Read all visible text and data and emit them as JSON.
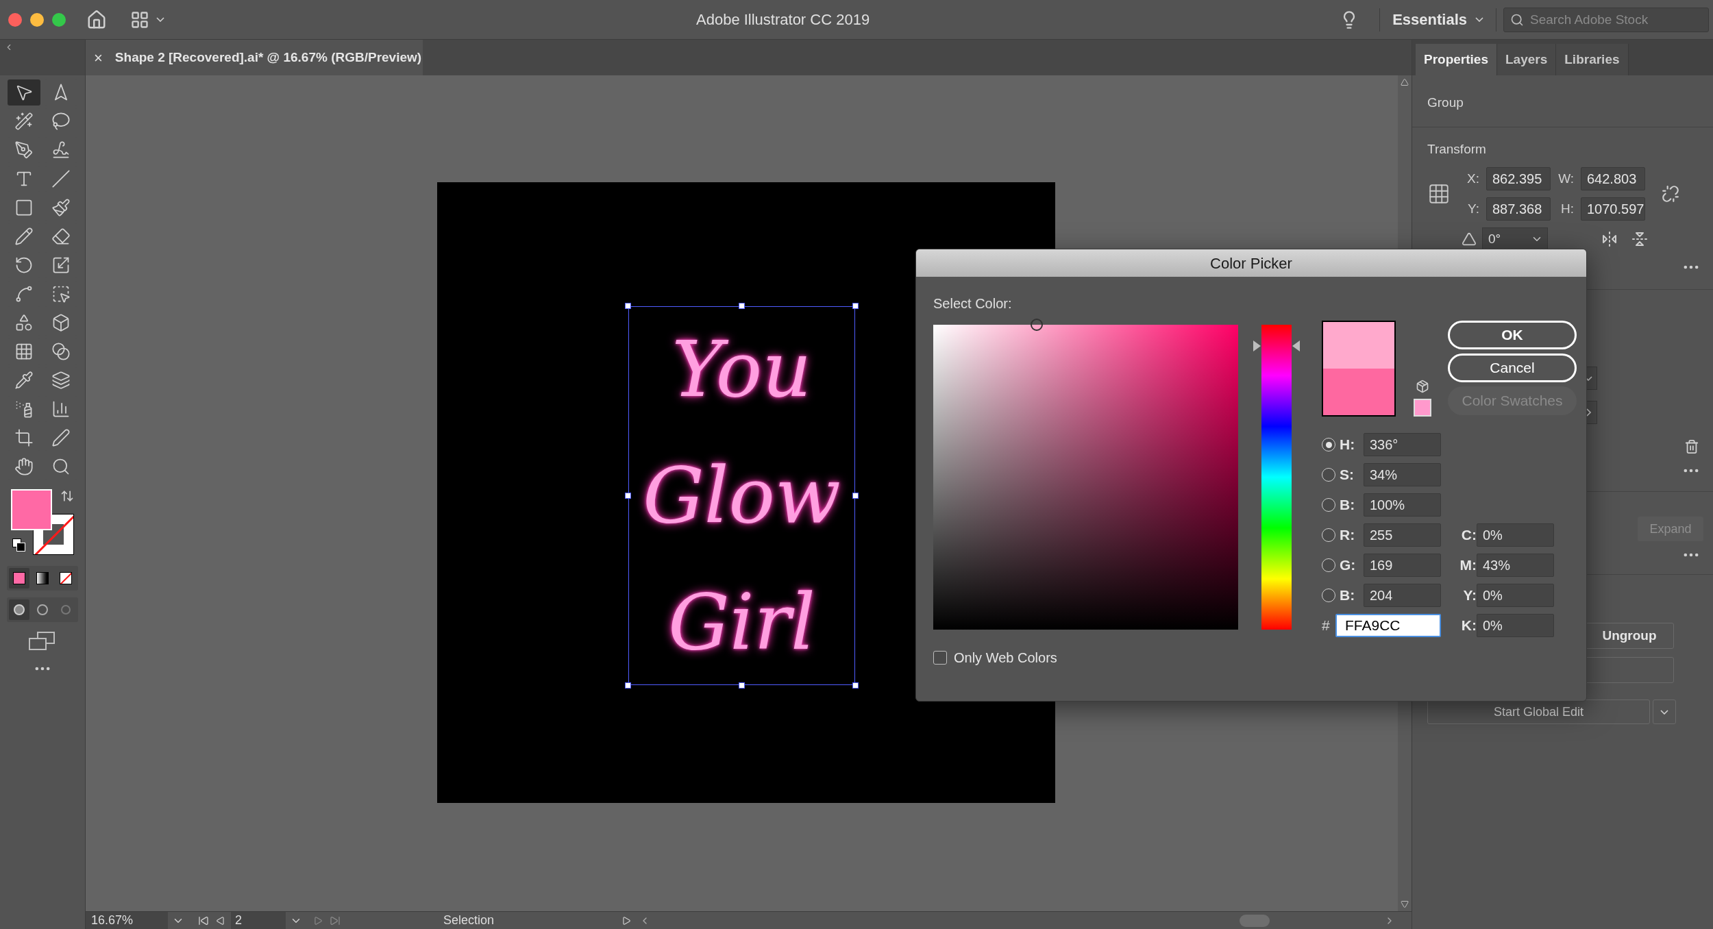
{
  "window": {
    "title": "Adobe Illustrator CC 2019",
    "traffic_lights": [
      {
        "color": "#fc605c"
      },
      {
        "color": "#fdbc40"
      },
      {
        "color": "#34c84a"
      }
    ]
  },
  "app_bar": {
    "workspace": "Essentials",
    "search": {
      "placeholder": "Search Adobe Stock"
    }
  },
  "document_tab": {
    "close": "×",
    "title": "Shape 2 [Recovered].ai* @ 16.67% (RGB/Preview)"
  },
  "toolbar": {
    "tools": [
      {
        "selected": true
      },
      {
        "selected": false
      },
      {
        "selected": false
      },
      {
        "selected": false
      },
      {
        "selected": false
      },
      {
        "selected": false
      },
      {
        "selected": false
      },
      {
        "selected": false
      },
      {
        "selected": false
      },
      {
        "selected": false
      },
      {
        "selected": false
      },
      {
        "selected": false
      },
      {
        "selected": false
      },
      {
        "selected": false
      },
      {
        "selected": false
      },
      {
        "selected": false
      },
      {
        "selected": false
      },
      {
        "selected": false
      },
      {
        "selected": false
      },
      {
        "selected": false
      },
      {
        "selected": false
      },
      {
        "selected": false
      },
      {
        "selected": false
      },
      {
        "selected": false
      },
      {
        "selected": false
      },
      {
        "selected": false
      },
      {
        "selected": false
      },
      {
        "selected": false
      }
    ],
    "fill": {
      "color": "#ff69a5"
    }
  },
  "artwork": {
    "lines": [
      "You",
      "Glow",
      "Girl"
    ]
  },
  "properties_panel": {
    "tabs": [
      {
        "label": "Properties",
        "selected": true
      },
      {
        "label": "Layers",
        "selected": false
      },
      {
        "label": "Libraries",
        "selected": false
      }
    ],
    "object": "Group",
    "transform_title": "Transform",
    "fields": [
      {
        "label": "X:",
        "value": "862.395"
      },
      {
        "label": "W:",
        "value": "642.803"
      },
      {
        "label": "Y:",
        "value": "887.368"
      },
      {
        "label": "H:",
        "value": "1070.597"
      }
    ],
    "angle": "0°",
    "expand": "Expand",
    "ungroup": "Ungroup",
    "start_global_edit": "Start Global Edit"
  },
  "color_picker": {
    "title": "Color Picker",
    "select_label": "Select Color:",
    "hue_slider": {
      "level": 0.93
    },
    "preview": [
      {
        "color": "#ffa9cc"
      },
      {
        "color": "#fe68a0"
      }
    ],
    "web_safe_swatch": {
      "color": "#ff99cc"
    },
    "buttons": [
      {
        "label": "OK",
        "disabled": false
      },
      {
        "label": "Cancel",
        "disabled": false
      },
      {
        "label": "Color Swatches",
        "disabled": true
      }
    ],
    "channels": [
      {
        "label": "H:",
        "value": "336°",
        "selected": true
      },
      {
        "label": "S:",
        "value": "34%",
        "selected": false
      },
      {
        "label": "B:",
        "value": "100%",
        "selected": false
      },
      {
        "label": "R:",
        "value": "255",
        "selected": false
      },
      {
        "label": "G:",
        "value": "169",
        "selected": false
      },
      {
        "label": "B:",
        "value": "204",
        "selected": false
      }
    ],
    "hex": {
      "label": "#",
      "value": "FFA9CC"
    },
    "cmyk": [
      {
        "label": "C:",
        "value": "0%"
      },
      {
        "label": "M:",
        "value": "43%"
      },
      {
        "label": "Y:",
        "value": "0%"
      },
      {
        "label": "K:",
        "value": "0%"
      }
    ],
    "only_web_colors": {
      "label": "Only Web Colors",
      "checked": false
    }
  },
  "status_bar": {
    "zoom": "16.67%",
    "artboard": "2",
    "tool": "Selection"
  }
}
